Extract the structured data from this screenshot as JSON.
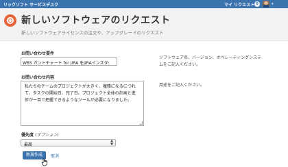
{
  "topbar": {
    "brand": "リックソフト サービスデスク",
    "my_requests": "マイ リクエスト",
    "badge_count": "0"
  },
  "header": {
    "title": "新しいソフトウェアのリクエスト",
    "subtitle": "新しいソフトウェアライセンスの注文や、アップグレードのリクエスト"
  },
  "form": {
    "summary": {
      "label": "お問い合わせ要件",
      "value": "WBS ガントチャート for JIRA をJIRAインスタ:"
    },
    "description": {
      "label": "お問い合わせ内容",
      "lines": [
        "私たちのチームのプロジェクトが大きく、複雑になるにつれ",
        "て、タスクの開始日、完了日、プロジェクト全体の計画と進",
        "捗が一目で把握できるようなツールが必要になりました。"
      ]
    },
    "priority": {
      "label": "優先度",
      "optional": "(オプション)",
      "value": "最高"
    },
    "create_button": "新規作成",
    "cancel_link": "取消"
  },
  "help": {
    "summary_lines": [
      "ソフトウェア名、バージョン、オペレーティングシステ",
      "ムをご記入ください。"
    ],
    "description": "用途をご記入ください。"
  },
  "colors": {
    "topbar": "#3b73af",
    "logo": "#e8643b",
    "button": "#3b73af"
  }
}
